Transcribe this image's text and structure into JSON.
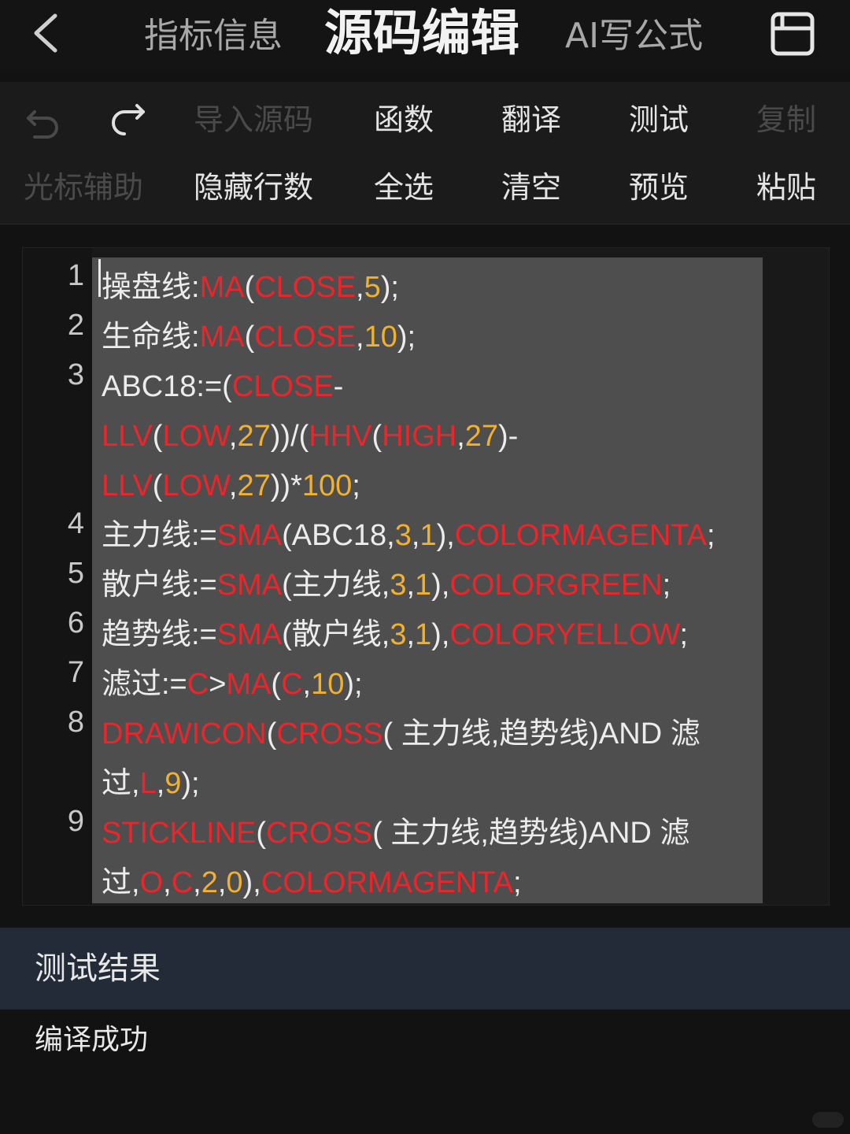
{
  "header": {
    "tabs": [
      {
        "label": "指标信息",
        "active": false
      },
      {
        "label": "源码编辑",
        "active": true
      },
      {
        "label": "AI写公式",
        "active": false
      }
    ]
  },
  "toolbar": {
    "row1": [
      {
        "label": "导入源码",
        "enabled": false
      },
      {
        "label": "函数",
        "enabled": true
      },
      {
        "label": "翻译",
        "enabled": true
      },
      {
        "label": "测试",
        "enabled": true
      },
      {
        "label": "复制",
        "enabled": false
      }
    ],
    "row2": [
      {
        "label": "光标辅助",
        "enabled": false
      },
      {
        "label": "隐藏行数",
        "enabled": true
      },
      {
        "label": "全选",
        "enabled": true
      },
      {
        "label": "清空",
        "enabled": true
      },
      {
        "label": "预览",
        "enabled": true
      },
      {
        "label": "粘贴",
        "enabled": true
      }
    ]
  },
  "colors": {
    "function": "#e8262b",
    "number": "#f0b030",
    "text": "#ececec",
    "selection": "#4e4e4e",
    "result_header": "#232b38"
  },
  "editor": {
    "lines": [
      {
        "n": "1",
        "segs": [
          [
            "w",
            "操盘线:"
          ],
          [
            "r",
            "MA"
          ],
          [
            "w",
            "("
          ],
          [
            "r",
            "CLOSE"
          ],
          [
            "w",
            ","
          ],
          [
            "o",
            "5"
          ],
          [
            "w",
            ");"
          ]
        ]
      },
      {
        "n": "2",
        "segs": [
          [
            "w",
            "生命线:"
          ],
          [
            "r",
            "MA"
          ],
          [
            "w",
            "("
          ],
          [
            "r",
            "CLOSE"
          ],
          [
            "w",
            ","
          ],
          [
            "o",
            "10"
          ],
          [
            "w",
            ");"
          ]
        ]
      },
      {
        "n": "3",
        "segs": [
          [
            "w",
            "ABC18:=("
          ],
          [
            "r",
            "CLOSE"
          ],
          [
            "w",
            "-"
          ]
        ]
      },
      {
        "n": "",
        "segs": [
          [
            "r",
            "LLV"
          ],
          [
            "w",
            "("
          ],
          [
            "r",
            "LOW"
          ],
          [
            "w",
            ","
          ],
          [
            "o",
            "27"
          ],
          [
            "w",
            "))/("
          ],
          [
            "r",
            "HHV"
          ],
          [
            "w",
            "("
          ],
          [
            "r",
            "HIGH"
          ],
          [
            "w",
            ","
          ],
          [
            "o",
            "27"
          ],
          [
            "w",
            ")-"
          ]
        ]
      },
      {
        "n": "",
        "segs": [
          [
            "r",
            "LLV"
          ],
          [
            "w",
            "("
          ],
          [
            "r",
            "LOW"
          ],
          [
            "w",
            ","
          ],
          [
            "o",
            "27"
          ],
          [
            "w",
            "))*"
          ],
          [
            "o",
            "100"
          ],
          [
            "w",
            ";"
          ]
        ]
      },
      {
        "n": "4",
        "segs": [
          [
            "w",
            "主力线:="
          ],
          [
            "r",
            "SMA"
          ],
          [
            "w",
            "(ABC18,"
          ],
          [
            "o",
            "3"
          ],
          [
            "w",
            ","
          ],
          [
            "o",
            "1"
          ],
          [
            "w",
            "),"
          ],
          [
            "r",
            "COLORMAGENTA"
          ],
          [
            "w",
            ";"
          ]
        ]
      },
      {
        "n": "5",
        "segs": [
          [
            "w",
            "散户线:="
          ],
          [
            "r",
            "SMA"
          ],
          [
            "w",
            "(主力线,"
          ],
          [
            "o",
            "3"
          ],
          [
            "w",
            ","
          ],
          [
            "o",
            "1"
          ],
          [
            "w",
            "),"
          ],
          [
            "r",
            "COLORGREEN"
          ],
          [
            "w",
            ";"
          ]
        ]
      },
      {
        "n": "6",
        "segs": [
          [
            "w",
            "趋势线:="
          ],
          [
            "r",
            "SMA"
          ],
          [
            "w",
            "(散户线,"
          ],
          [
            "o",
            "3"
          ],
          [
            "w",
            ","
          ],
          [
            "o",
            "1"
          ],
          [
            "w",
            "),"
          ],
          [
            "r",
            "COLORYELLOW"
          ],
          [
            "w",
            ";"
          ]
        ]
      },
      {
        "n": "7",
        "segs": [
          [
            "w",
            "滤过:="
          ],
          [
            "r",
            "C"
          ],
          [
            "w",
            ">"
          ],
          [
            "r",
            "MA"
          ],
          [
            "w",
            "("
          ],
          [
            "r",
            "C"
          ],
          [
            "w",
            ","
          ],
          [
            "o",
            "10"
          ],
          [
            "w",
            ");"
          ]
        ]
      },
      {
        "n": "8",
        "segs": [
          [
            "r",
            "DRAWICON"
          ],
          [
            "w",
            "("
          ],
          [
            "r",
            "CROSS"
          ],
          [
            "w",
            "( 主力线,趋势线)AND 滤"
          ]
        ]
      },
      {
        "n": "",
        "segs": [
          [
            "w",
            "过,"
          ],
          [
            "r",
            "L"
          ],
          [
            "w",
            ","
          ],
          [
            "o",
            "9"
          ],
          [
            "w",
            ");"
          ]
        ]
      },
      {
        "n": "9",
        "segs": [
          [
            "r",
            "STICKLINE"
          ],
          [
            "w",
            "("
          ],
          [
            "r",
            "CROSS"
          ],
          [
            "w",
            "( 主力线,趋势线)AND 滤"
          ]
        ]
      },
      {
        "n": "",
        "segs": [
          [
            "w",
            "过,"
          ],
          [
            "r",
            "O"
          ],
          [
            "w",
            ","
          ],
          [
            "r",
            "C"
          ],
          [
            "w",
            ","
          ],
          [
            "o",
            "2"
          ],
          [
            "w",
            ","
          ],
          [
            "o",
            "0"
          ],
          [
            "w",
            "),"
          ],
          [
            "r",
            "COLORMAGENTA"
          ],
          [
            "w",
            ";"
          ]
        ]
      }
    ]
  },
  "result": {
    "title": "测试结果",
    "message": "编译成功"
  }
}
